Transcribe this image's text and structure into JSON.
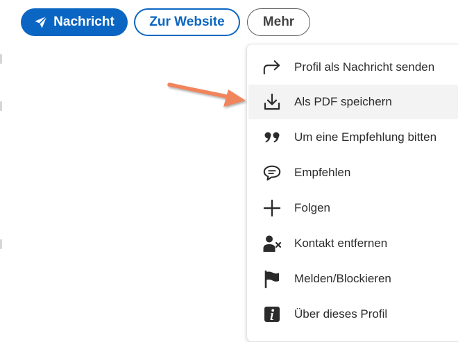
{
  "actions": {
    "message_label": "Nachricht",
    "website_label": "Zur Website",
    "more_label": "Mehr"
  },
  "menu": {
    "items": [
      {
        "label": "Profil als Nachricht senden",
        "icon": "share-arrow-icon"
      },
      {
        "label": "Als PDF speichern",
        "icon": "download-icon",
        "highlighted": true
      },
      {
        "label": "Um eine Empfehlung bitten",
        "icon": "quote-icon"
      },
      {
        "label": "Empfehlen",
        "icon": "speech-bubble-icon"
      },
      {
        "label": "Folgen",
        "icon": "plus-icon"
      },
      {
        "label": "Kontakt entfernen",
        "icon": "remove-contact-icon"
      },
      {
        "label": "Melden/Blockieren",
        "icon": "flag-icon"
      },
      {
        "label": "Über dieses Profil",
        "icon": "info-icon"
      }
    ]
  },
  "colors": {
    "primary": "#0a66c2",
    "menu_highlight": "#f3f3f3",
    "annotation_arrow": "#f0845c",
    "icon": "#2b2b2b"
  }
}
